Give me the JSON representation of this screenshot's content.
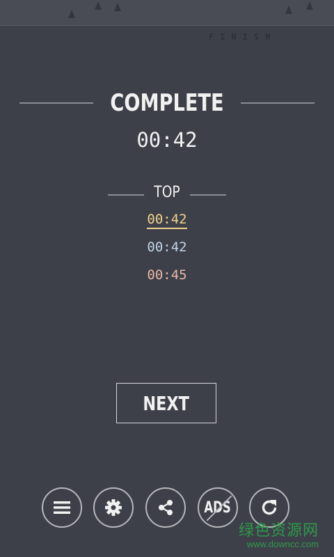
{
  "header": {
    "finish_label": "FINISH"
  },
  "result": {
    "title": "COMPLETE",
    "time": "00:42"
  },
  "leaderboard": {
    "label": "TOP",
    "scores": [
      "00:42",
      "00:42",
      "00:45"
    ],
    "colors": [
      "#f0d48c",
      "#bfd6e6",
      "#e8b8a8"
    ]
  },
  "actions": {
    "next_label": "NEXT",
    "ads_label": "ADS",
    "toolbar_icons": [
      "menu-icon",
      "gear-icon",
      "share-icon",
      "no-ads-icon",
      "restart-icon"
    ]
  },
  "watermark": {
    "title": "绿色资源网",
    "url": "www.downcc.com",
    "color": "#2c9a4a"
  },
  "theme": {
    "background": "#3e4049",
    "line_color": "#8a8c94"
  }
}
